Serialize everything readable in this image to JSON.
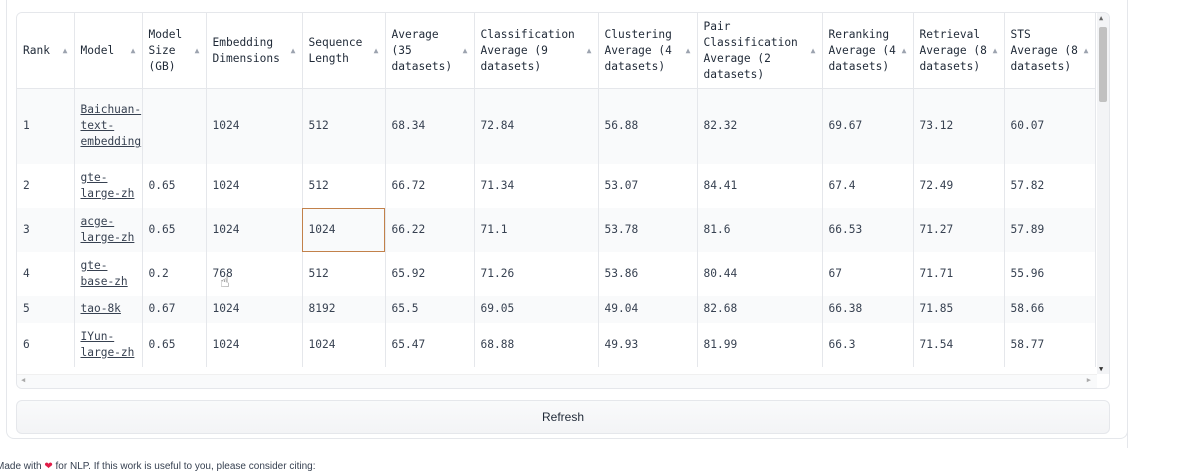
{
  "table": {
    "columns": [
      {
        "label": "Rank"
      },
      {
        "label": "Model"
      },
      {
        "label": "Model Size (GB)"
      },
      {
        "label": "Embedding Dimensions"
      },
      {
        "label": "Sequence Length"
      },
      {
        "label": "Average (35 datasets)"
      },
      {
        "label": "Classification Average (9 datasets)"
      },
      {
        "label": "Clustering Average (4 datasets)"
      },
      {
        "label": "Pair Classification Average (2 datasets)"
      },
      {
        "label": "Reranking Average (4 datasets)"
      },
      {
        "label": "Retrieval Average (8 datasets)"
      },
      {
        "label": "STS Average (8 datasets)"
      }
    ],
    "sort_icon": "▲",
    "rows": [
      [
        "1",
        "Baichuan-text-embedding",
        "",
        "1024",
        "512",
        "68.34",
        "72.84",
        "56.88",
        "82.32",
        "69.67",
        "73.12",
        "60.07"
      ],
      [
        "2",
        "gte-large-zh",
        "0.65",
        "1024",
        "512",
        "66.72",
        "71.34",
        "53.07",
        "84.41",
        "67.4",
        "72.49",
        "57.82"
      ],
      [
        "3",
        "acge-large-zh",
        "0.65",
        "1024",
        "1024",
        "66.22",
        "71.1",
        "53.78",
        "81.6",
        "66.53",
        "71.27",
        "57.89"
      ],
      [
        "4",
        "gte-base-zh",
        "0.2",
        "768",
        "512",
        "65.92",
        "71.26",
        "53.86",
        "80.44",
        "67",
        "71.71",
        "55.96"
      ],
      [
        "5",
        "tao-8k",
        "0.67",
        "1024",
        "8192",
        "65.5",
        "69.05",
        "49.04",
        "82.68",
        "66.38",
        "71.85",
        "58.66"
      ],
      [
        "6",
        "IYun-large-zh",
        "0.65",
        "1024",
        "1024",
        "65.47",
        "68.88",
        "49.93",
        "81.99",
        "66.3",
        "71.54",
        "58.77"
      ]
    ]
  },
  "refresh_label": "Refresh",
  "footer": {
    "prefix": "Made with",
    "suffix": "for NLP. If this work is useful to you, please consider citing:"
  },
  "colors": {
    "selected_cell_border": "#c2814a",
    "heart": "#e11d48"
  }
}
